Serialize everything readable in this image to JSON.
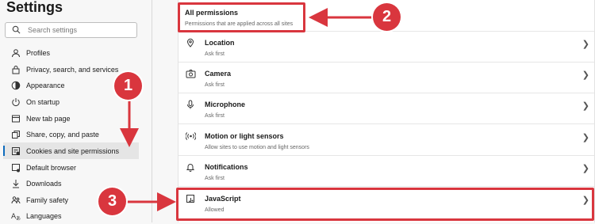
{
  "sidebar": {
    "title": "Settings",
    "search_placeholder": "Search settings",
    "items": [
      {
        "label": "Profiles",
        "icon": "profile-icon"
      },
      {
        "label": "Privacy, search, and services",
        "icon": "lock-icon"
      },
      {
        "label": "Appearance",
        "icon": "appearance-icon"
      },
      {
        "label": "On startup",
        "icon": "power-icon"
      },
      {
        "label": "New tab page",
        "icon": "new-tab-icon"
      },
      {
        "label": "Share, copy, and paste",
        "icon": "share-icon"
      },
      {
        "label": "Cookies and site permissions",
        "icon": "cookie-icon",
        "active": true
      },
      {
        "label": "Default browser",
        "icon": "browser-icon"
      },
      {
        "label": "Downloads",
        "icon": "download-icon"
      },
      {
        "label": "Family safety",
        "icon": "family-icon"
      },
      {
        "label": "Languages",
        "icon": "language-icon"
      }
    ]
  },
  "permissions": {
    "header_title": "All permissions",
    "header_subtitle": "Permissions that are applied across all sites",
    "rows": [
      {
        "title": "Location",
        "subtitle": "Ask first",
        "icon": "location-icon"
      },
      {
        "title": "Camera",
        "subtitle": "Ask first",
        "icon": "camera-icon"
      },
      {
        "title": "Microphone",
        "subtitle": "Ask first",
        "icon": "microphone-icon"
      },
      {
        "title": "Motion or light sensors",
        "subtitle": "Allow sites to use motion and light sensors",
        "icon": "sensor-icon"
      },
      {
        "title": "Notifications",
        "subtitle": "Ask first",
        "icon": "bell-icon"
      },
      {
        "title": "JavaScript",
        "subtitle": "Allowed",
        "icon": "javascript-icon"
      }
    ]
  },
  "annotations": {
    "badge_1": "1",
    "badge_2": "2",
    "badge_3": "3",
    "color": "#d9363e"
  },
  "colors": {
    "accent": "#0f6cbd",
    "active_bg": "#e5e5e5"
  }
}
